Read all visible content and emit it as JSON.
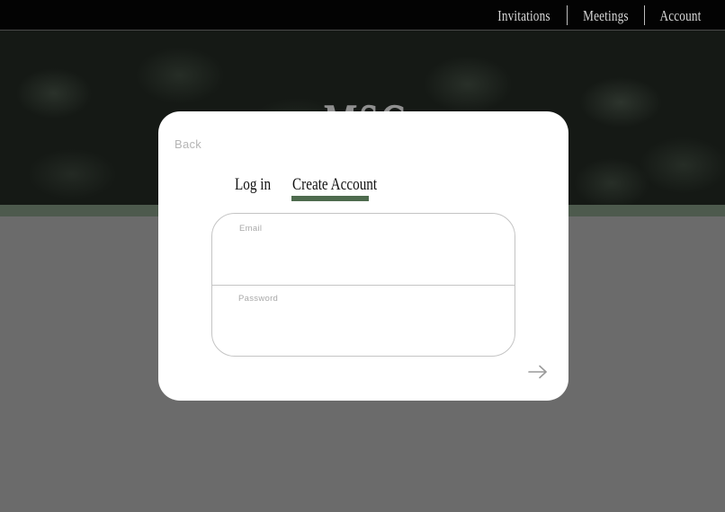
{
  "nav": {
    "items": [
      "Invitations",
      "Meetings",
      "Account"
    ]
  },
  "hero": {
    "logo_text": "MSG"
  },
  "modal": {
    "back_label": "Back",
    "tabs": [
      {
        "label": "Log in",
        "active": false
      },
      {
        "label": "Create Account",
        "active": true
      }
    ],
    "fields": {
      "email": {
        "label": "Email",
        "value": ""
      },
      "password": {
        "label": "Password",
        "value": ""
      }
    },
    "submit_icon": "arrow-right-icon"
  },
  "colors": {
    "topbar": "#030303",
    "accent": "#4e6b4e",
    "page_background": "#6b6b6b",
    "modal_background": "#ffffff"
  }
}
